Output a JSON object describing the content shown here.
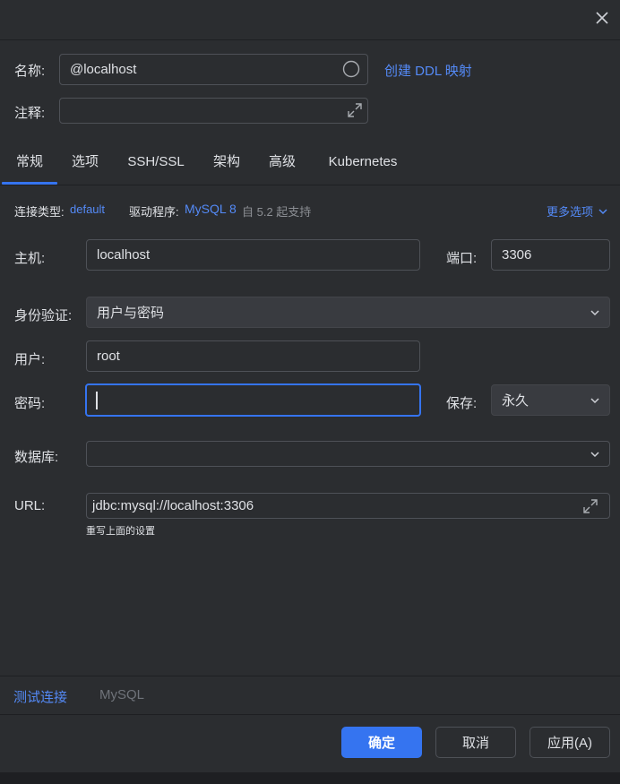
{
  "header": {
    "name_label": "名称:",
    "name_value": "@localhost",
    "ddl_link": "创建 DDL 映射",
    "comment_label": "注释:"
  },
  "tabs": [
    "常规",
    "选项",
    "SSH/SSL",
    "架构",
    "高级",
    "Kubernetes"
  ],
  "info": {
    "conn_type_label": "连接类型:",
    "conn_type_value": "default",
    "driver_label": "驱动程序:",
    "driver_value": "MySQL 8",
    "driver_support": "自 5.2 起支持",
    "more_options": "更多选项"
  },
  "form": {
    "host_label": "主机:",
    "host_value": "localhost",
    "port_label": "端口:",
    "port_value": "3306",
    "auth_label": "身份验证:",
    "auth_value": "用户与密码",
    "user_label": "用户:",
    "user_value": "root",
    "password_label": "密码:",
    "password_value": "",
    "save_label": "保存:",
    "save_value": "永久",
    "database_label": "数据库:",
    "database_value": "",
    "url_label": "URL:",
    "url_value": "jdbc:mysql://localhost:3306",
    "url_hint": "重写上面的设置"
  },
  "bottom": {
    "test_link": "测试连接",
    "db_type": "MySQL"
  },
  "buttons": {
    "ok": "确定",
    "cancel": "取消",
    "apply": "应用(A)"
  },
  "colors": {
    "accent": "#3574f0",
    "link": "#548af7",
    "background": "#2b2d30"
  }
}
